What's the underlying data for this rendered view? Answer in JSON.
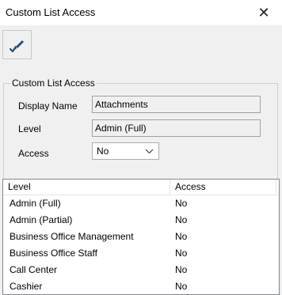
{
  "window": {
    "title": "Custom List Access",
    "close_glyph": "✕"
  },
  "toolbar": {
    "edit_icon": "pencil-check-icon",
    "icon_color": "#1f4e79"
  },
  "group": {
    "legend": "Custom List Access",
    "display_name_label": "Display Name",
    "display_name_value": "Attachments",
    "level_label": "Level",
    "level_value": "Admin (Full)",
    "access_label": "Access",
    "access_value": "No"
  },
  "list": {
    "columns": [
      "Level",
      "Access"
    ],
    "rows": [
      {
        "level": "Admin (Full)",
        "access": "No"
      },
      {
        "level": "Admin (Partial)",
        "access": "No"
      },
      {
        "level": "Business Office Management",
        "access": "No"
      },
      {
        "level": "Business Office Staff",
        "access": "No"
      },
      {
        "level": "Call Center",
        "access": "No"
      },
      {
        "level": "Cashier",
        "access": "No"
      }
    ]
  }
}
